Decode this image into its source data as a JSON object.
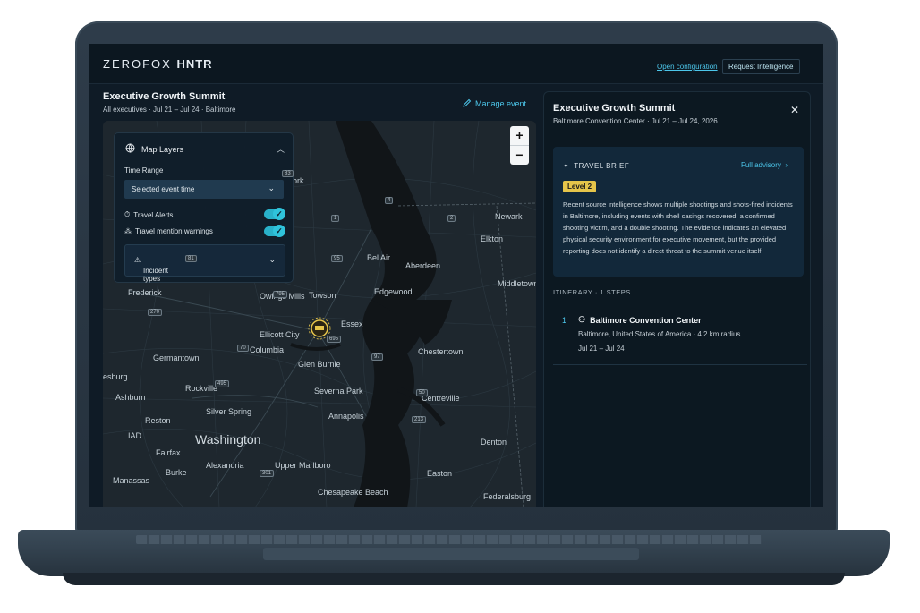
{
  "app": {
    "logo_prefix": "ZEROFOX",
    "logo_suffix": "HNTR"
  },
  "topbar": {
    "open_config": "Open configuration",
    "request_intel": "Request Intelligence"
  },
  "event": {
    "title": "Executive Growth Summit",
    "subtitle": "All executives · Jul 21 – Jul 24 · Baltimore",
    "manage_label": "Manage event"
  },
  "map": {
    "zoom_in": "+",
    "zoom_out": "−",
    "labels": [
      "Frederick",
      "Owings Mills",
      "Towson",
      "Bel Air",
      "Aberdeen",
      "Edgewood",
      "Newark",
      "Elkton",
      "Middletown",
      "Essex",
      "Ellicott City",
      "Columbia",
      "Germantown",
      "Glen Burnie",
      "Rockville",
      "Severna Park",
      "Chestertown",
      "Ashburn",
      "Silver Spring",
      "Centreville",
      "Annapolis",
      "Reston",
      "Washington",
      "IAD",
      "Fairfax",
      "Upper Marlboro",
      "Denton",
      "Alexandria",
      "Burke",
      "Easton",
      "Manassas",
      "Chesapeake Beach",
      "Federalsburg",
      "esburg",
      "ork"
    ],
    "highways": [
      "83",
      "95",
      "81",
      "695",
      "270",
      "795",
      "70",
      "97",
      "301",
      "50",
      "495",
      "4",
      "2",
      "1",
      "213"
    ]
  },
  "layers": {
    "title": "Map Layers",
    "time_range_label": "Time Range",
    "time_range_value": "Selected event time",
    "toggle_alerts": "Travel Alerts",
    "toggle_mentions": "Travel mention warnings",
    "incident_types": "Incident types"
  },
  "panel": {
    "title": "Executive Growth Summit",
    "subtitle": "Baltimore Convention Center · Jul 21 – Jul 24, 2026",
    "brief_title": "TRAVEL BRIEF",
    "full_advisory": "Full advisory",
    "level": "Level 2",
    "brief_text": "Recent source intelligence shows multiple shootings and shots-fired incidents in Baltimore, including events with shell casings recovered, a confirmed shooting victim, and a double shooting. The evidence indicates an elevated physical security environment for executive movement, but the provided reporting does not identify a direct threat to the summit venue itself.",
    "itinerary_header": "ITINERARY · 1 STEPS",
    "steps": [
      {
        "num": "1",
        "name": "Baltimore Convention Center",
        "location": "Baltimore, United States of America · 4.2 km radius",
        "dates": "Jul 21 – Jul 24"
      }
    ]
  },
  "colors": {
    "accent": "#4cc6ea",
    "badge": "#e6c54a",
    "toggle": "#2fc3db"
  }
}
